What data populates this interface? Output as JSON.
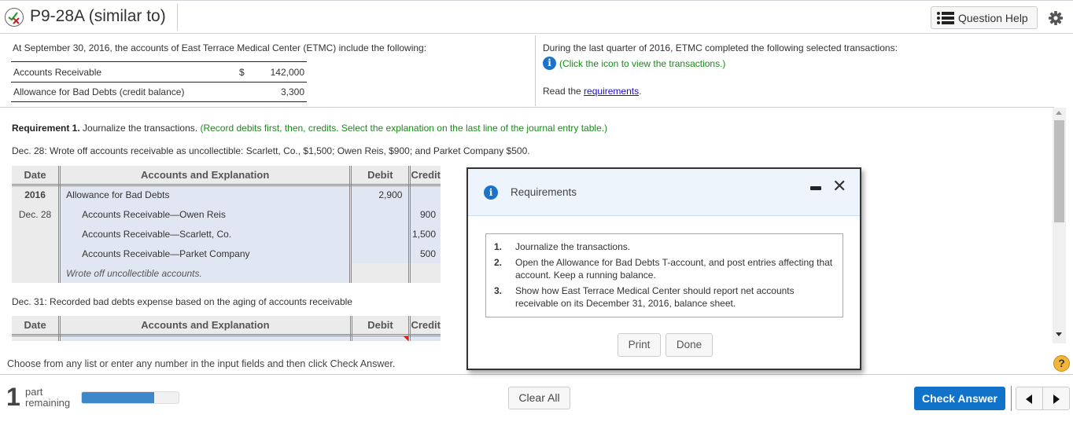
{
  "header": {
    "title": "P9-28A (similar to)",
    "status_icon": "partial-correct-icon",
    "question_help_label": "Question Help",
    "settings_icon": "gear-icon"
  },
  "intro": {
    "left_text": "At September 30, 2016, the accounts of East Terrace Medical Center (ETMC) include the following:",
    "accounts": [
      {
        "name": "Accounts Receivable",
        "currency": "$",
        "value": "142,000"
      },
      {
        "name": "Allowance for Bad Debts (credit balance)",
        "currency": "",
        "value": "3,300"
      }
    ],
    "right_text": "During the last quarter of 2016, ETMC completed the following selected transactions:",
    "info_text": "(Click the icon to view the transactions.)",
    "read_prefix": "Read the ",
    "read_link": "requirements",
    "read_suffix": "."
  },
  "main": {
    "req_label": "Requirement 1.",
    "req_text": " Journalize the transactions. ",
    "req_instruction": "(Record debits first, then, credits. Select the explanation on the last line of the journal entry table.)",
    "dec28_text": "Dec. 28: Wrote off accounts receivable as uncollectible: Scarlett, Co., $1,500; Owen Reis, $900; and Parket Company $500.",
    "table_headers": {
      "date": "Date",
      "accounts": "Accounts and Explanation",
      "debit": "Debit",
      "credit": "Credit"
    },
    "journal1": {
      "rows": [
        {
          "date": "2016",
          "account": "Allowance for Bad Debts",
          "debit": "2,900",
          "credit": ""
        },
        {
          "date": "Dec. 28",
          "account": "Accounts Receivable—Owen Reis",
          "debit": "",
          "credit": "900"
        },
        {
          "date": "",
          "account": "Accounts Receivable—Scarlett, Co.",
          "debit": "",
          "credit": "1,500"
        },
        {
          "date": "",
          "account": "Accounts Receivable—Parket Company",
          "debit": "",
          "credit": "500"
        }
      ],
      "explanation": "Wrote off uncollectible accounts."
    },
    "dec31_text": "Dec. 31: Recorded bad debts expense based on the aging of accounts receivable",
    "choose_text": "Choose from any list or enter any number in the input fields and then click Check Answer."
  },
  "modal": {
    "title": "Requirements",
    "items": [
      {
        "num": "1.",
        "text": "Journalize the transactions."
      },
      {
        "num": "2.",
        "text": "Open the Allowance for Bad Debts T-account, and post entries affecting that account. Keep a running balance."
      },
      {
        "num": "3.",
        "text": "Show how East Terrace Medical Center should report net accounts receivable on its December 31, 2016, balance sheet."
      }
    ],
    "print_label": "Print",
    "done_label": "Done"
  },
  "footer": {
    "parts_remaining": "1",
    "parts_label_1": "part",
    "parts_label_2": "remaining",
    "progress_fraction": 0.75,
    "clear_all_label": "Clear All",
    "check_answer_label": "Check Answer",
    "help_symbol": "?"
  },
  "colors": {
    "primary_button": "#1172c9",
    "progress_fill": "#3d88c9",
    "instruction_green": "#1a8a1a",
    "info_blue": "#1a73c9",
    "link_blue": "#1a0dcc"
  }
}
